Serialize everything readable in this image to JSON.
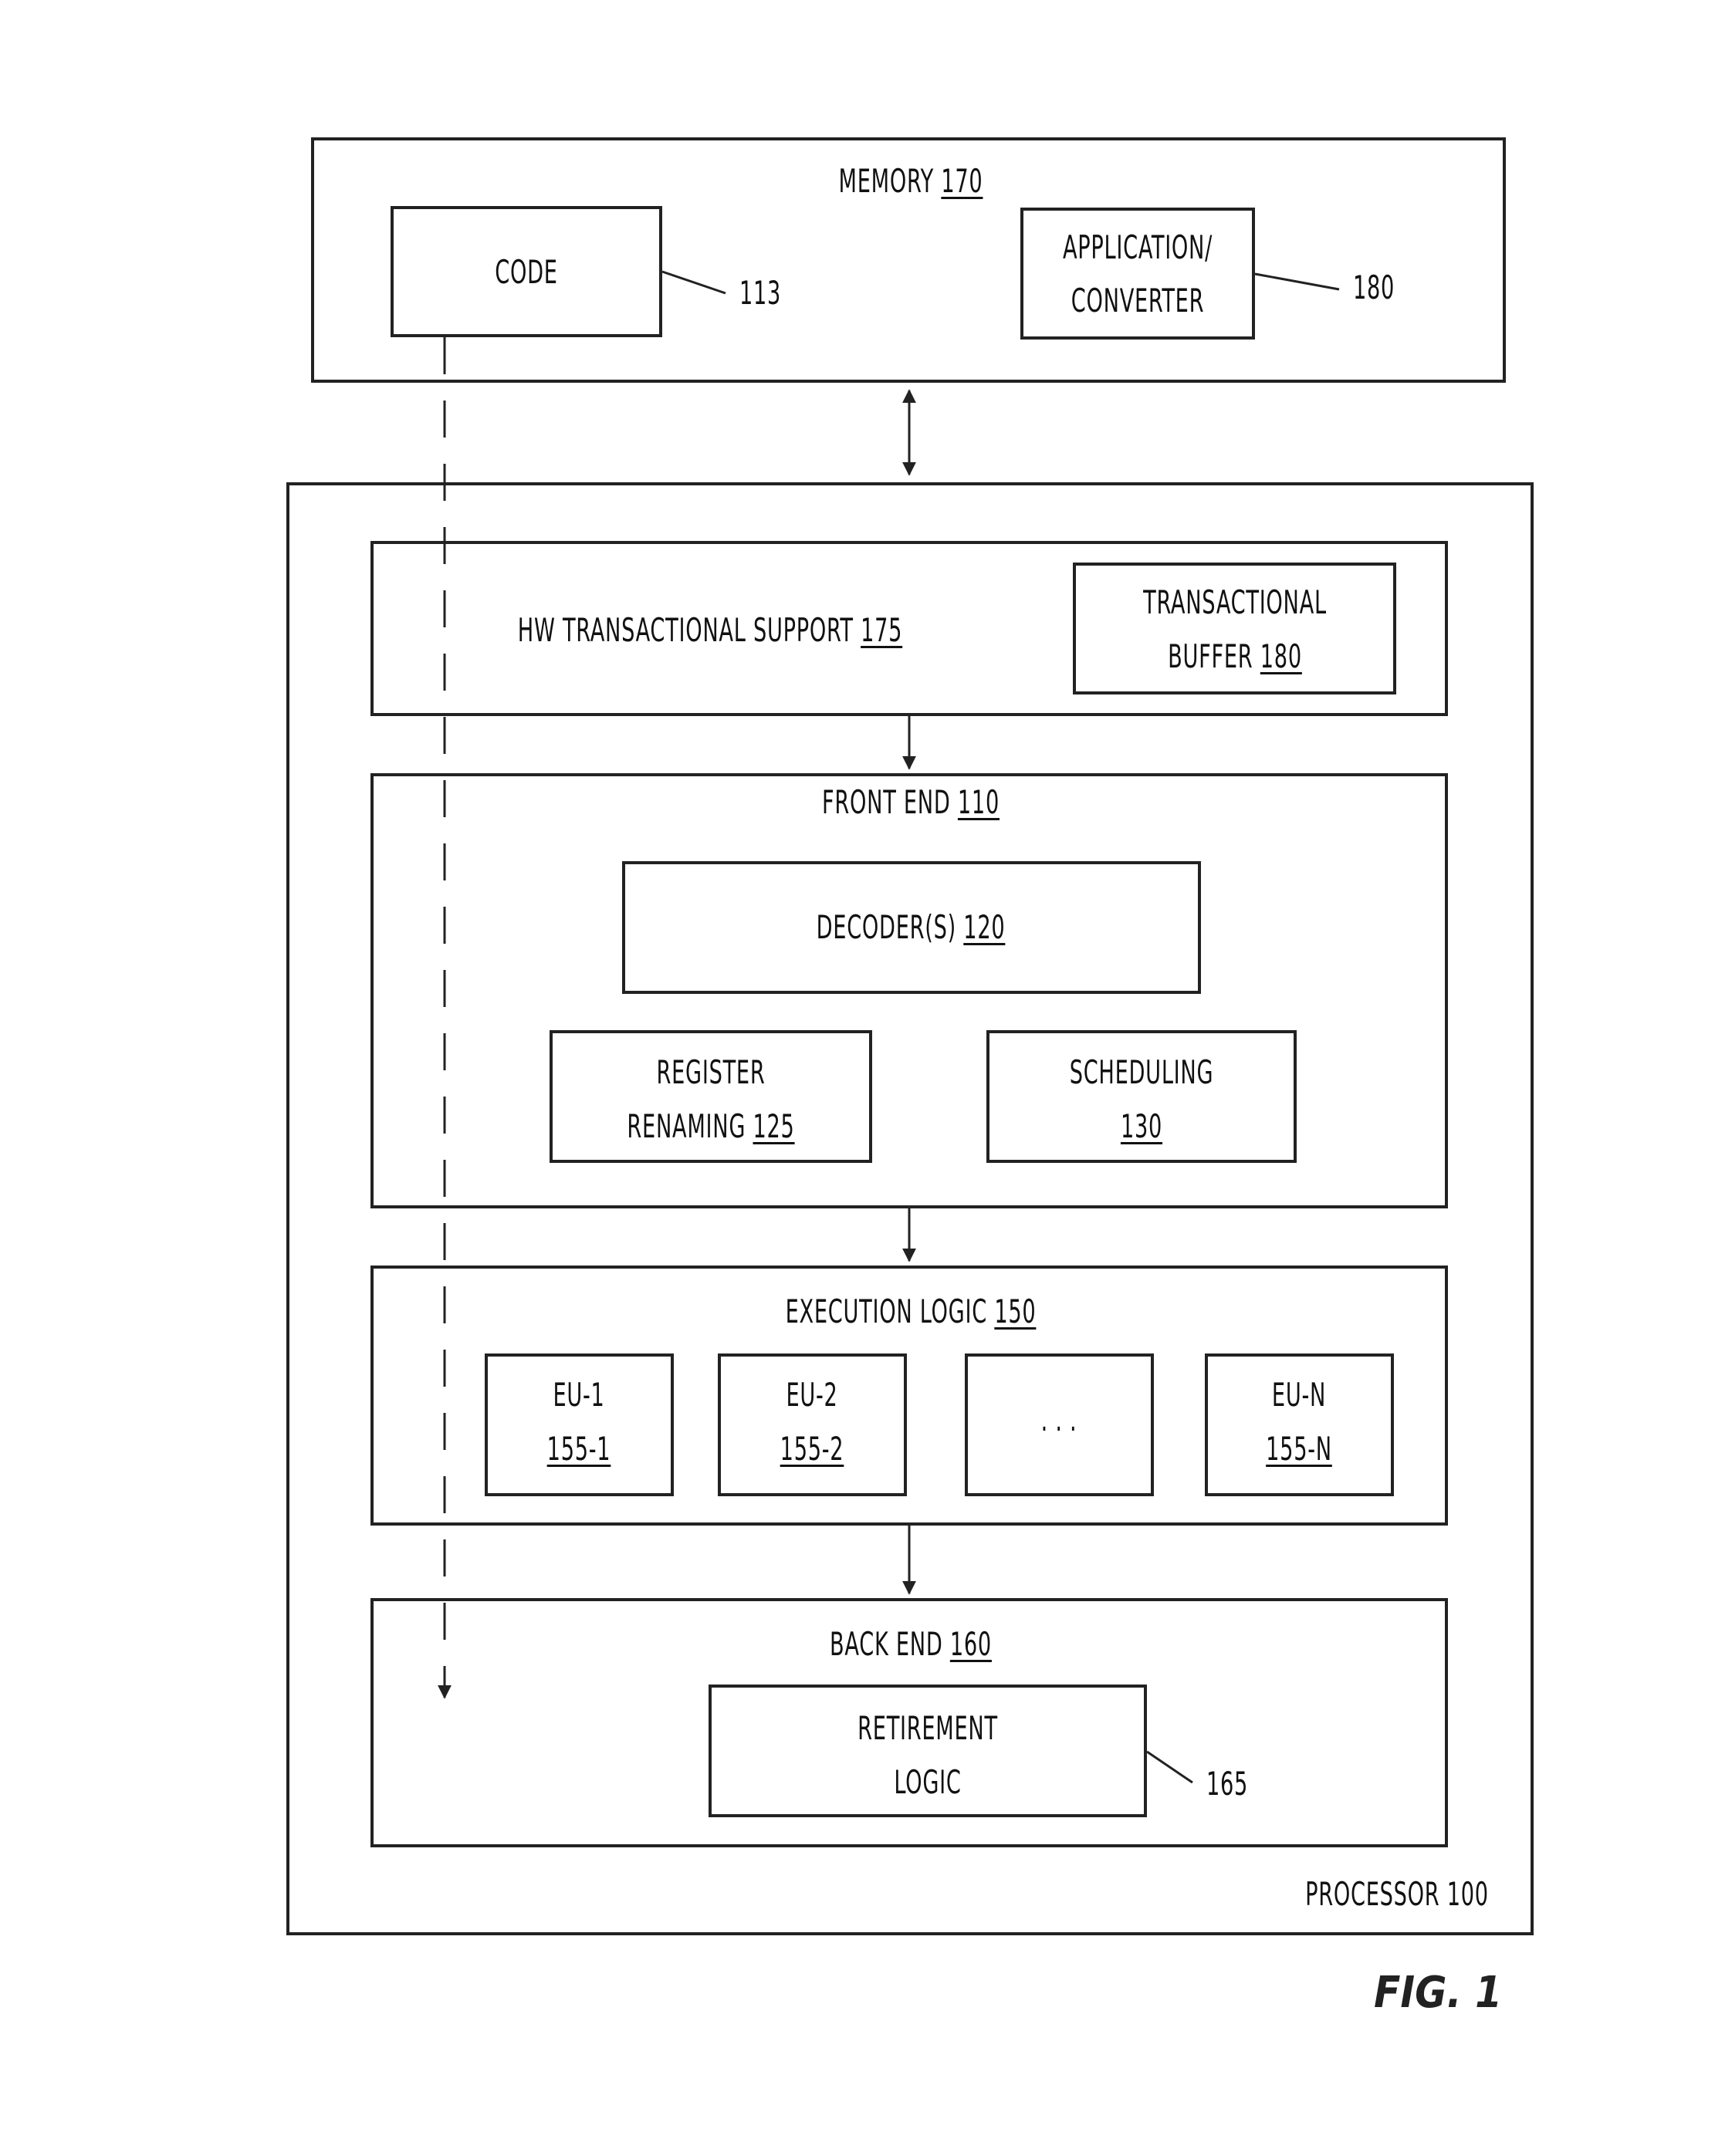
{
  "figure_label": "FIG. 1",
  "memory": {
    "title": "MEMORY",
    "ref": "170",
    "code": {
      "label": "CODE",
      "callout": "113"
    },
    "application": {
      "line1": "APPLICATION/",
      "line2": "CONVERTER",
      "callout": "180"
    }
  },
  "processor": {
    "label": "PROCESSOR 100",
    "hw_support": {
      "title": "HW TRANSACTIONAL SUPPORT",
      "ref": "175",
      "buffer": {
        "line1": "TRANSACTIONAL",
        "line2": "BUFFER",
        "ref": "180"
      }
    },
    "front_end": {
      "title": "FRONT END",
      "ref": "110",
      "decoder": {
        "label": "DECODER(S)",
        "ref": "120"
      },
      "register_renaming": {
        "line1": "REGISTER",
        "line2": "RENAMING",
        "ref": "125"
      },
      "scheduling": {
        "line1": "SCHEDULING",
        "ref": "130"
      }
    },
    "execution_logic": {
      "title": "EXECUTION LOGIC",
      "ref": "150",
      "units": [
        {
          "name": "EU-1",
          "ref": "155-1"
        },
        {
          "name": "EU-2",
          "ref": "155-2"
        },
        {
          "name": ". . .",
          "ref": ""
        },
        {
          "name": "EU-N",
          "ref": "155-N"
        }
      ]
    },
    "back_end": {
      "title": "BACK END",
      "ref": "160",
      "retirement": {
        "line1": "RETIREMENT",
        "line2": "LOGIC",
        "callout": "165"
      }
    }
  }
}
